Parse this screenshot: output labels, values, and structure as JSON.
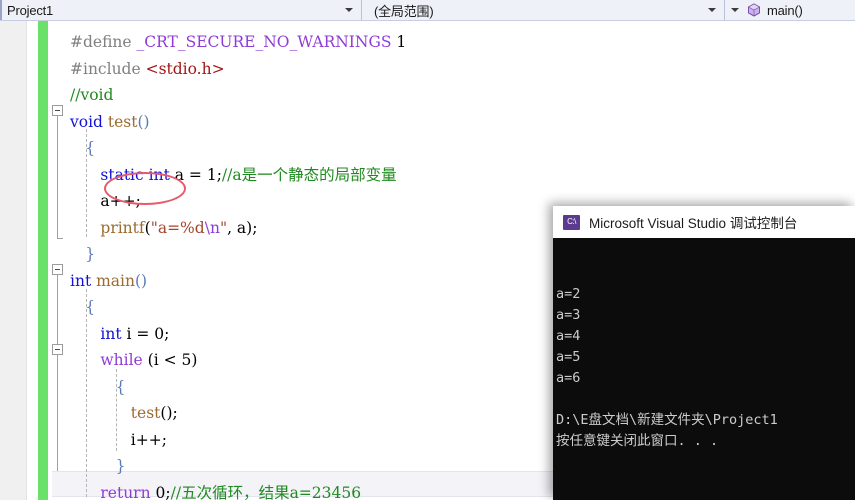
{
  "navbar": {
    "project_combo": "Project1",
    "scope_combo": "(全局范围)",
    "member_combo": "main()",
    "member_icon": "method-cube-icon"
  },
  "editor": {
    "lines": [
      {
        "indent": 0,
        "tokens": [
          {
            "t": "#define ",
            "c": "t-pre"
          },
          {
            "t": "_CRT_SECURE_NO_WARNINGS",
            "c": "t-macro"
          },
          {
            "t": " 1",
            "c": "t-num"
          }
        ]
      },
      {
        "indent": 0,
        "tokens": [
          {
            "t": "#include ",
            "c": "t-pre"
          },
          {
            "t": "<stdio.h>",
            "c": "t-inc"
          }
        ]
      },
      {
        "indent": 0,
        "tokens": [
          {
            "t": "//void",
            "c": "t-cmt"
          }
        ]
      },
      {
        "indent": 0,
        "tokens": [
          {
            "t": "void",
            "c": "t-kw"
          },
          {
            "t": " ",
            "c": "t-id"
          },
          {
            "t": "test",
            "c": "t-fn"
          },
          {
            "t": "()",
            "c": "t-brace"
          }
        ]
      },
      {
        "indent": 1,
        "tokens": [
          {
            "t": "{",
            "c": "t-brace"
          }
        ]
      },
      {
        "indent": 2,
        "tokens": [
          {
            "t": "static",
            "c": "t-kw"
          },
          {
            "t": " ",
            "c": "t-id"
          },
          {
            "t": "int",
            "c": "t-kw"
          },
          {
            "t": " a = ",
            "c": "t-id"
          },
          {
            "t": "1",
            "c": "t-num"
          },
          {
            "t": ";",
            "c": "t-punct"
          },
          {
            "t": "//a是一个静态的局部变量",
            "c": "t-cmt"
          }
        ]
      },
      {
        "indent": 2,
        "tokens": [
          {
            "t": "a++;",
            "c": "t-id"
          }
        ]
      },
      {
        "indent": 2,
        "tokens": [
          {
            "t": "printf",
            "c": "t-fn"
          },
          {
            "t": "(",
            "c": "t-punct"
          },
          {
            "t": "\"a=%d",
            "c": "t-str"
          },
          {
            "t": "\\n",
            "c": "t-esc"
          },
          {
            "t": "\"",
            "c": "t-str"
          },
          {
            "t": ", a);",
            "c": "t-id"
          }
        ]
      },
      {
        "indent": 1,
        "tokens": [
          {
            "t": "}",
            "c": "t-brace"
          }
        ]
      },
      {
        "indent": 0,
        "tokens": [
          {
            "t": "int",
            "c": "t-kw"
          },
          {
            "t": " ",
            "c": "t-id"
          },
          {
            "t": "main",
            "c": "t-fn"
          },
          {
            "t": "()",
            "c": "t-brace"
          }
        ]
      },
      {
        "indent": 1,
        "tokens": [
          {
            "t": "{",
            "c": "t-brace"
          }
        ]
      },
      {
        "indent": 2,
        "tokens": [
          {
            "t": "int",
            "c": "t-kw"
          },
          {
            "t": " i = ",
            "c": "t-id"
          },
          {
            "t": "0",
            "c": "t-num"
          },
          {
            "t": ";",
            "c": "t-punct"
          }
        ]
      },
      {
        "indent": 2,
        "tokens": [
          {
            "t": "while",
            "c": "t-kw2"
          },
          {
            "t": " (i < ",
            "c": "t-id"
          },
          {
            "t": "5",
            "c": "t-num"
          },
          {
            "t": ")",
            "c": "t-id"
          }
        ]
      },
      {
        "indent": 3,
        "tokens": [
          {
            "t": "{",
            "c": "t-brace"
          }
        ]
      },
      {
        "indent": 4,
        "tokens": [
          {
            "t": "test",
            "c": "t-fn"
          },
          {
            "t": "();",
            "c": "t-punct"
          }
        ]
      },
      {
        "indent": 4,
        "tokens": [
          {
            "t": "i++;",
            "c": "t-id"
          }
        ]
      },
      {
        "indent": 3,
        "tokens": [
          {
            "t": "}",
            "c": "t-brace"
          }
        ]
      },
      {
        "indent": 2,
        "tokens": [
          {
            "t": "return",
            "c": "t-kw2"
          },
          {
            "t": " ",
            "c": "t-id"
          },
          {
            "t": "0",
            "c": "t-num"
          },
          {
            "t": ";",
            "c": "t-punct"
          },
          {
            "t": "//五次循环，结果a=23456",
            "c": "t-cmt"
          }
        ]
      }
    ],
    "annotation": {
      "kind": "red-ellipse",
      "target": "static"
    },
    "change_bar_color": "#6ae26a",
    "current_line_index": 17
  },
  "console": {
    "title": "Microsoft Visual Studio 调试控制台",
    "icon_label": "C:\\",
    "output": [
      "a=2",
      "a=3",
      "a=4",
      "a=5",
      "a=6",
      "",
      "D:\\E盘文档\\新建文件夹\\Project1",
      "按任意键关闭此窗口. . ."
    ]
  }
}
